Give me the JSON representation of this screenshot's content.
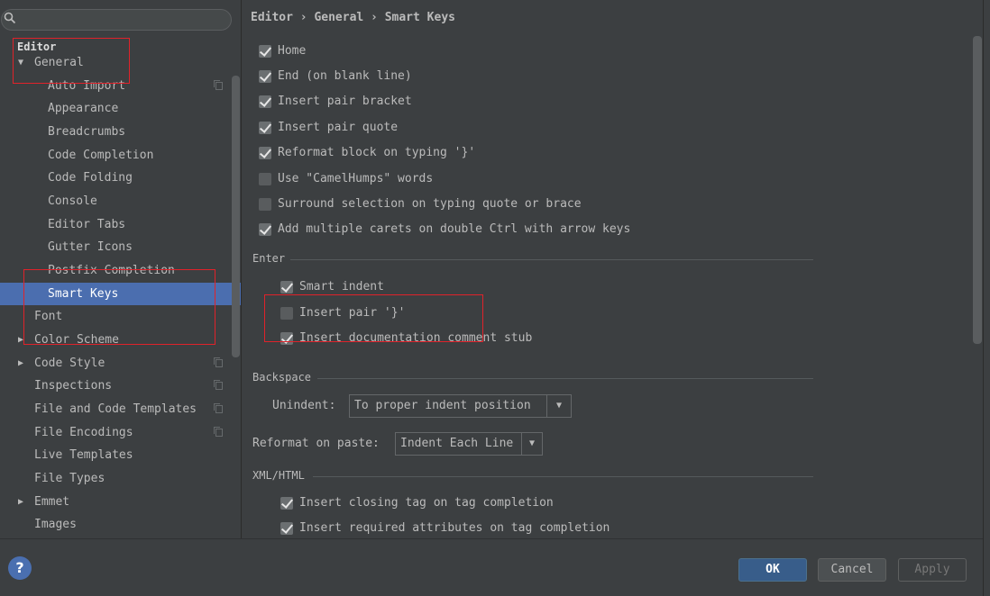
{
  "search": {
    "placeholder": ""
  },
  "tree": {
    "editor": "Editor",
    "general": "General",
    "items": [
      {
        "label": "Auto Import"
      },
      {
        "label": "Appearance"
      },
      {
        "label": "Breadcrumbs"
      },
      {
        "label": "Code Completion"
      },
      {
        "label": "Code Folding"
      },
      {
        "label": "Console"
      },
      {
        "label": "Editor Tabs"
      },
      {
        "label": "Gutter Icons"
      },
      {
        "label": "Postfix Completion"
      },
      {
        "label": "Smart Keys"
      }
    ],
    "top_items": [
      {
        "label": "Font"
      },
      {
        "label": "Color Scheme"
      },
      {
        "label": "Code Style"
      },
      {
        "label": "Inspections"
      },
      {
        "label": "File and Code Templates"
      },
      {
        "label": "File Encodings"
      },
      {
        "label": "Live Templates"
      },
      {
        "label": "File Types"
      },
      {
        "label": "Emmet"
      },
      {
        "label": "Images"
      }
    ],
    "selected": "Smart Keys"
  },
  "breadcrumb": "Editor › General › Smart Keys",
  "options": [
    {
      "label": "Home",
      "checked": true
    },
    {
      "label": "End (on blank line)",
      "checked": true
    },
    {
      "label": "Insert pair bracket",
      "checked": true
    },
    {
      "label": "Insert pair quote",
      "checked": true
    },
    {
      "label": "Reformat block on typing '}'",
      "checked": true
    },
    {
      "label": "Use \"CamelHumps\" words",
      "checked": false
    },
    {
      "label": "Surround selection on typing quote or brace",
      "checked": false
    },
    {
      "label": "Add multiple carets on double Ctrl with arrow keys",
      "checked": true
    }
  ],
  "enter": {
    "title": "Enter",
    "options": [
      {
        "label": "Smart indent",
        "checked": true
      },
      {
        "label": "Insert pair '}'",
        "checked": false
      },
      {
        "label": "Insert documentation comment stub",
        "checked": true
      }
    ]
  },
  "backspace": {
    "title": "Backspace",
    "unindent_label": "Unindent:",
    "unindent_value": "To proper indent position"
  },
  "reformat": {
    "label": "Reformat on paste:",
    "value": "Indent Each Line"
  },
  "xml": {
    "title": "XML/HTML",
    "options": [
      {
        "label": "Insert closing tag on tag completion",
        "checked": true
      },
      {
        "label": "Insert required attributes on tag completion",
        "checked": true
      }
    ]
  },
  "buttons": {
    "help": "?",
    "ok": "OK",
    "cancel": "Cancel",
    "apply": "Apply"
  },
  "colors": {
    "selection": "#4b6eaf",
    "background": "#3c3f41",
    "highlight_box": "#e0222a"
  }
}
